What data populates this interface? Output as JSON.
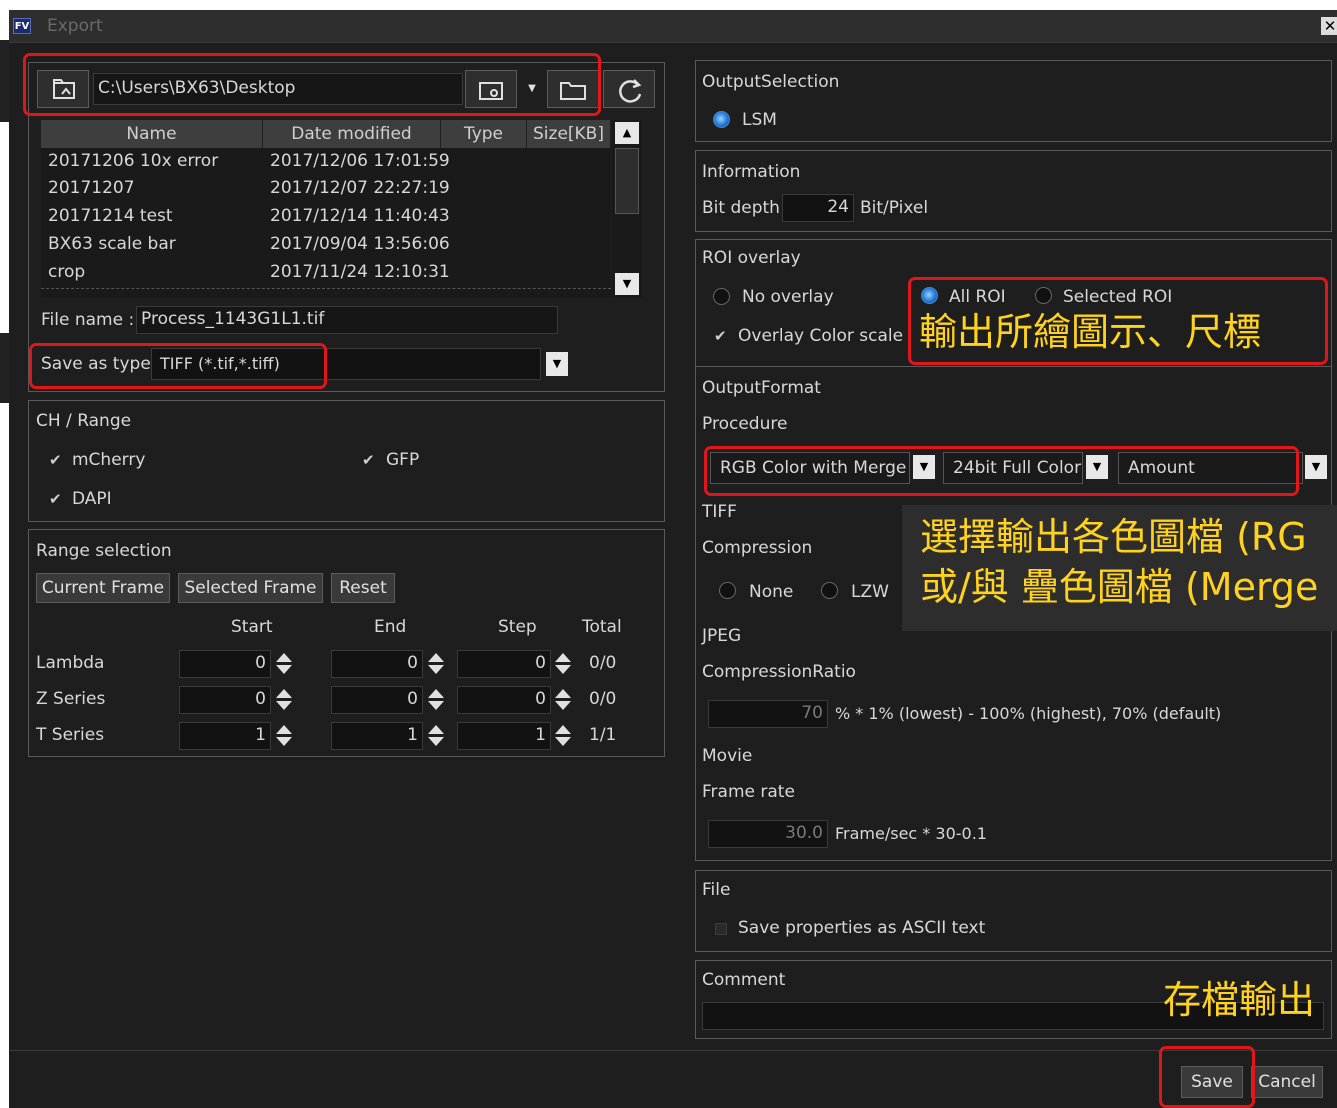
{
  "window": {
    "title": "Export",
    "logo": "FV"
  },
  "browser": {
    "path": "C:\\Users\\BX63\\Desktop",
    "columns": [
      "Name",
      "Date modified",
      "Type",
      "Size[KB]"
    ],
    "rows": [
      {
        "name": "20171206 10x error",
        "date": "2017/12/06 17:01:59"
      },
      {
        "name": "20171207",
        "date": "2017/12/07 22:27:19"
      },
      {
        "name": "20171214 test",
        "date": "2017/12/14 11:40:43"
      },
      {
        "name": "BX63 scale bar",
        "date": "2017/09/04 13:56:06"
      },
      {
        "name": "crop",
        "date": "2017/11/24 12:10:31"
      }
    ],
    "file_name_label": "File name :",
    "file_name": "Process_1143G1L1.tif",
    "save_type_label": "Save as type:",
    "save_type": "TIFF (*.tif,*.tiff)"
  },
  "channels": {
    "title": "CH / Range",
    "items": [
      "mCherry",
      "GFP",
      "DAPI"
    ]
  },
  "range": {
    "title": "Range selection",
    "buttons": [
      "Current Frame",
      "Selected Frame",
      "Reset"
    ],
    "headers": [
      "Start",
      "End",
      "Step",
      "Total"
    ],
    "rows": [
      {
        "label": "Lambda",
        "start": "0",
        "end": "0",
        "step": "0",
        "total": "0/0"
      },
      {
        "label": "Z Series",
        "start": "0",
        "end": "0",
        "step": "0",
        "total": "0/0"
      },
      {
        "label": "T Series",
        "start": "1",
        "end": "1",
        "step": "1",
        "total": "1/1"
      }
    ]
  },
  "output_selection": {
    "title": "OutputSelection",
    "option": "LSM"
  },
  "information": {
    "title": "Information",
    "bit_depth_label": "Bit depth",
    "bit_depth": "24",
    "unit": "Bit/Pixel"
  },
  "roi": {
    "title": "ROI overlay",
    "no_overlay": "No overlay",
    "all_roi": "All ROI",
    "selected_roi": "Selected ROI",
    "overlay_color_scale": "Overlay Color scale"
  },
  "output_format": {
    "title": "OutputFormat",
    "procedure_label": "Procedure",
    "procedure": "RGB Color with Merge",
    "color": "24bit Full Color",
    "amount": "Amount",
    "tiff_label": "TIFF",
    "compression_label": "Compression",
    "compression_none": "None",
    "compression_lzw": "LZW",
    "jpeg_label": "JPEG",
    "ratio_label": "CompressionRatio",
    "ratio_value": "70",
    "ratio_hint": "% * 1% (lowest) - 100% (highest), 70% (default)",
    "movie_label": "Movie",
    "frame_rate_label": "Frame rate",
    "frame_rate_value": "30.0",
    "frame_rate_hint": "Frame/sec * 30-0.1"
  },
  "file_group": {
    "title": "File",
    "save_props": "Save properties as ASCII text"
  },
  "comment": {
    "title": "Comment"
  },
  "footer": {
    "save": "Save",
    "cancel": "Cancel"
  },
  "annotations": {
    "roi": "輸出所繪圖示、尺標",
    "format_line1": "選擇輸出各色圖檔 (RG",
    "format_line2": "或/與 疊色圖檔 (Merge",
    "save": "存檔輸出"
  },
  "colors": {
    "annotation_text": "#ffd21f",
    "annotation_box": "#e0161b",
    "background": "#1e1e1e"
  }
}
